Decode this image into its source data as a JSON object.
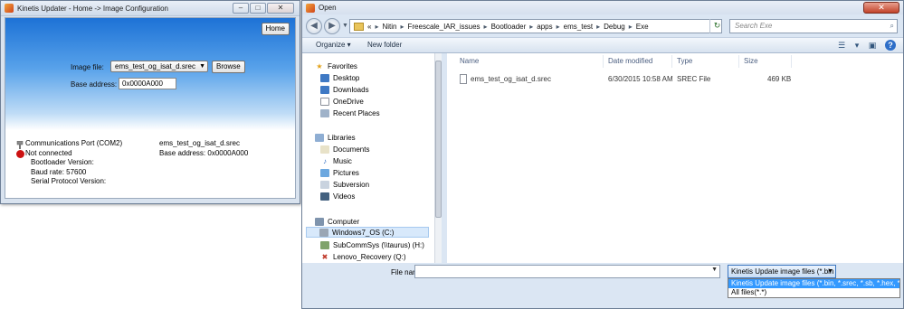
{
  "left_window": {
    "title": "Kinetis Updater - Home -> Image Configuration",
    "minimize": "–",
    "maximize": "□",
    "close": "✕",
    "home_button": "Home",
    "image_file_label": "Image file:",
    "image_file_value": "ems_test_og_isat_d.srec",
    "browse_button": "Browse",
    "base_address_label": "Base address:",
    "base_address_value": "0x0000A000",
    "status": {
      "port": "Communications Port (COM2)",
      "connection": "Not connected",
      "bootloader_version": "Bootloader Version:",
      "baud_rate": "Baud rate: 57600",
      "serial_protocol_version": "Serial Protocol Version:"
    },
    "file_info": {
      "name": "ems_test_og_isat_d.srec",
      "base_address": "Base address: 0x0000A000"
    }
  },
  "dialog": {
    "title": "Open",
    "close": "✕",
    "path": [
      "«",
      "Nitin",
      "Freescale_IAR_issues",
      "Bootloader",
      "apps",
      "ems_test",
      "Debug",
      "Exe"
    ],
    "search_placeholder": "Search Exe",
    "toolbar": {
      "organize": "Organize ▾",
      "new_folder": "New folder"
    },
    "nav": {
      "favorites": "Favorites",
      "desktop": "Desktop",
      "downloads": "Downloads",
      "onedrive": "OneDrive",
      "recent": "Recent Places",
      "libraries": "Libraries",
      "documents": "Documents",
      "music": "Music",
      "pictures": "Pictures",
      "subversion": "Subversion",
      "videos": "Videos",
      "computer": "Computer",
      "drive_c": "Windows7_OS (C:)",
      "drive_h": "SubCommSys (\\\\taurus) (H:)",
      "drive_q": "Lenovo_Recovery (Q:)"
    },
    "columns": {
      "name": "Name",
      "date": "Date modified",
      "type": "Type",
      "size": "Size"
    },
    "files": [
      {
        "name": "ems_test_og_isat_d.srec",
        "date": "6/30/2015 10:58 AM",
        "type": "SREC File",
        "size": "469 KB"
      }
    ],
    "file_name_label": "File name:",
    "file_name_value": "",
    "file_type_selected": "Kinetis Update image files (*.bin",
    "file_type_options": [
      "Kinetis Update image files (*.bin, *.srec, *.sb, *.hex, *.elf)",
      "All files(*.*)"
    ]
  }
}
